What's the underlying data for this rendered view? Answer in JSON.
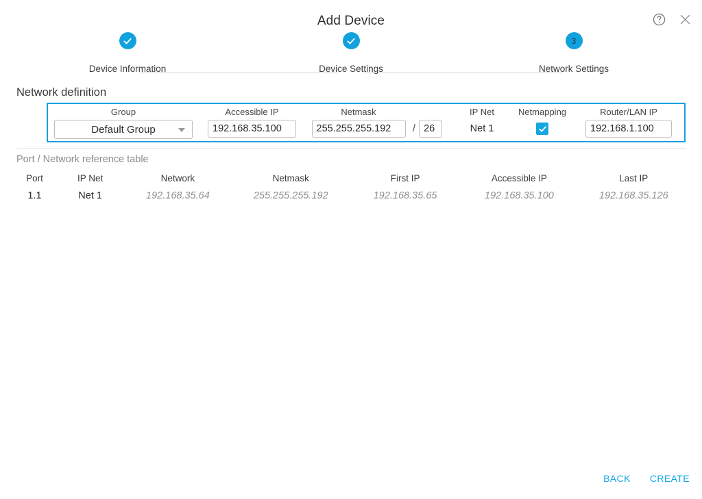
{
  "dialog": {
    "title": "Add Device",
    "help_icon": "help-circle-icon",
    "close_icon": "close-icon"
  },
  "stepper": {
    "steps": [
      {
        "label": "Device Information",
        "state": "complete",
        "marker": "✓"
      },
      {
        "label": "Device Settings",
        "state": "complete",
        "marker": "✓"
      },
      {
        "label": "Network Settings",
        "state": "current",
        "marker": "3"
      }
    ],
    "accent_color": "#11a2dd"
  },
  "network_definition": {
    "heading": "Network definition",
    "fields": {
      "group": {
        "label": "Group",
        "value": "Default Group",
        "caret_icon": "chevron-down-icon"
      },
      "accessible_ip": {
        "label": "Accessible IP",
        "value": "192.168.35.100"
      },
      "netmask": {
        "label": "Netmask",
        "value": "255.255.255.192",
        "separator": "/",
        "prefix": "26"
      },
      "ip_net": {
        "label": "IP Net",
        "value": "Net 1"
      },
      "netmapping": {
        "label": "Netmapping",
        "checked": true,
        "check_icon": "✓"
      },
      "router_lan_ip": {
        "label": "Router/LAN IP",
        "value": "192.168.1.100"
      }
    },
    "border_color": "#1a9ee0"
  },
  "reference_table": {
    "caption": "Port / Network reference table",
    "columns": [
      "Port",
      "IP Net",
      "Network",
      "Netmask",
      "First IP",
      "Accessible IP",
      "Last IP"
    ],
    "rows": [
      {
        "port": "1.1",
        "ip_net": "Net 1",
        "network": "192.168.35.64",
        "netmask": "255.255.255.192",
        "first_ip": "192.168.35.65",
        "accessible_ip": "192.168.35.100",
        "last_ip": "192.168.35.126"
      }
    ]
  },
  "footer": {
    "back_label": "BACK",
    "create_label": "CREATE",
    "link_color": "#13a6e6"
  }
}
